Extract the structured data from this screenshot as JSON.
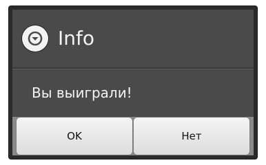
{
  "dialog": {
    "title": "Info",
    "title_icon": "chevron-down-circle-icon",
    "message": "Вы выиграли!",
    "buttons": {
      "ok_label": "OK",
      "no_label": "Нет"
    }
  },
  "colors": {
    "title_background": "#4a4a4a",
    "button_bar_background": "#8a8a8a",
    "text_light": "#f4f4f4"
  }
}
